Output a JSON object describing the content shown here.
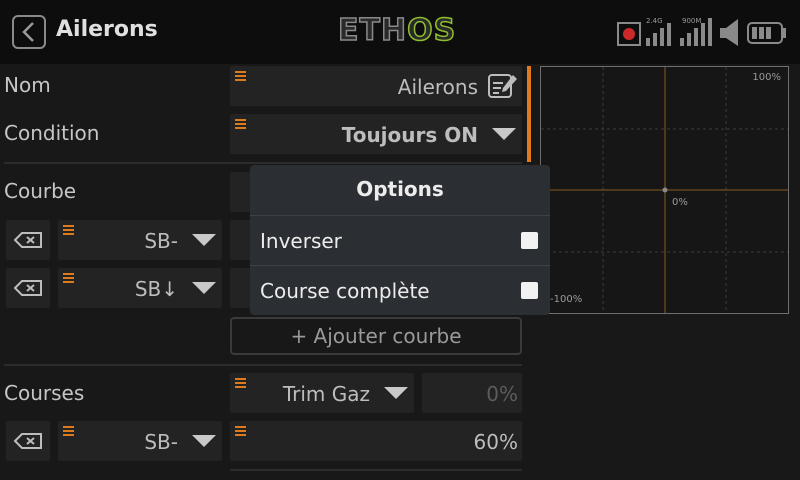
{
  "header": {
    "title": "Ailerons",
    "logo_part1": "ETH",
    "logo_part2": "OS",
    "radio_label_1": "2.4G",
    "radio_label_2": "900M",
    "accent_color": "#e07a1e",
    "logo_green": "#8fbf2c"
  },
  "form": {
    "nom_label": "Nom",
    "nom_value": "Ailerons",
    "condition_label": "Condition",
    "condition_value": "Toujours ON",
    "courbe_label": "Courbe",
    "curve_rows": [
      {
        "source": "SB-"
      },
      {
        "source": "SB↓"
      }
    ],
    "add_curve_label": "+ Ajouter courbe",
    "courses_label": "Courses",
    "courses_source": "Trim Gaz",
    "courses_value": "0%",
    "course_row": {
      "source": "SB-",
      "value": "60%"
    }
  },
  "graph": {
    "label_top": "100%",
    "label_center": "0%",
    "label_bottom": "-100%"
  },
  "popup": {
    "title": "Options",
    "items": [
      {
        "label": "Inverser",
        "checked": false
      },
      {
        "label": "Course complète",
        "checked": false
      }
    ]
  }
}
